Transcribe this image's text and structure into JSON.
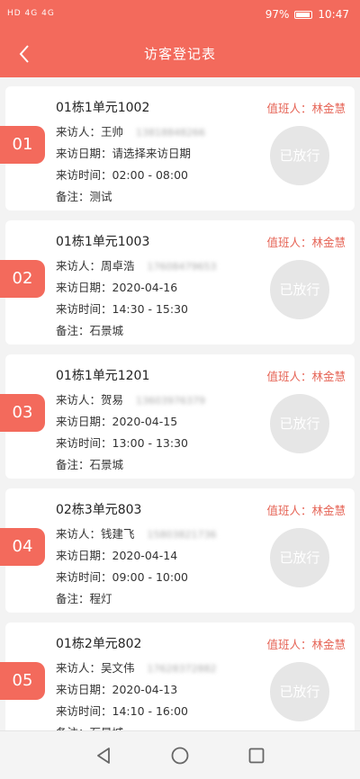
{
  "statusbar": {
    "left_text": "HD 4G 4G",
    "battery": "97%",
    "time": "10:47"
  },
  "header": {
    "title": "访客登记表"
  },
  "records": [
    {
      "index": "01",
      "room": "01栋1单元1002",
      "duty": "值班人：林金慧",
      "visitor": "来访人：王帅",
      "phone": "13818848266",
      "date": "来访日期：请选择来访日期",
      "time": "来访时间：02:00 - 08:00",
      "note": "备注：测试",
      "status": "已放行"
    },
    {
      "index": "02",
      "room": "01栋1单元1003",
      "duty": "值班人：林金慧",
      "visitor": "来访人：周卓浩",
      "phone": "17608479653",
      "date": "来访日期：2020-04-16",
      "time": "来访时间：14:30 - 15:30",
      "note": "备注：石景城",
      "status": "已放行"
    },
    {
      "index": "03",
      "room": "01栋1单元1201",
      "duty": "值班人：林金慧",
      "visitor": "来访人：贺易",
      "phone": "13603976379",
      "date": "来访日期：2020-04-15",
      "time": "来访时间：13:00 - 13:30",
      "note": "备注：石景城",
      "status": "已放行"
    },
    {
      "index": "04",
      "room": "02栋3单元803",
      "duty": "值班人：林金慧",
      "visitor": "来访人：钱建飞",
      "phone": "15803821736",
      "date": "来访日期：2020-04-14",
      "time": "来访时间：09:00 - 10:00",
      "note": "备注：程灯",
      "status": "已放行"
    },
    {
      "index": "05",
      "room": "01栋2单元802",
      "duty": "值班人：林金慧",
      "visitor": "来访人：吴文伟",
      "phone": "17628372882",
      "date": "来访日期：2020-04-13",
      "time": "来访时间：14:10 - 16:00",
      "note": "备注：石景城",
      "status": "已放行"
    }
  ],
  "icons": {
    "back": "chevron-left-icon",
    "nav_back": "triangle-back-icon",
    "nav_home": "circle-home-icon",
    "nav_recent": "square-recent-icon"
  },
  "colors": {
    "accent": "#f36a5c",
    "stamp": "#e6e6e6"
  }
}
